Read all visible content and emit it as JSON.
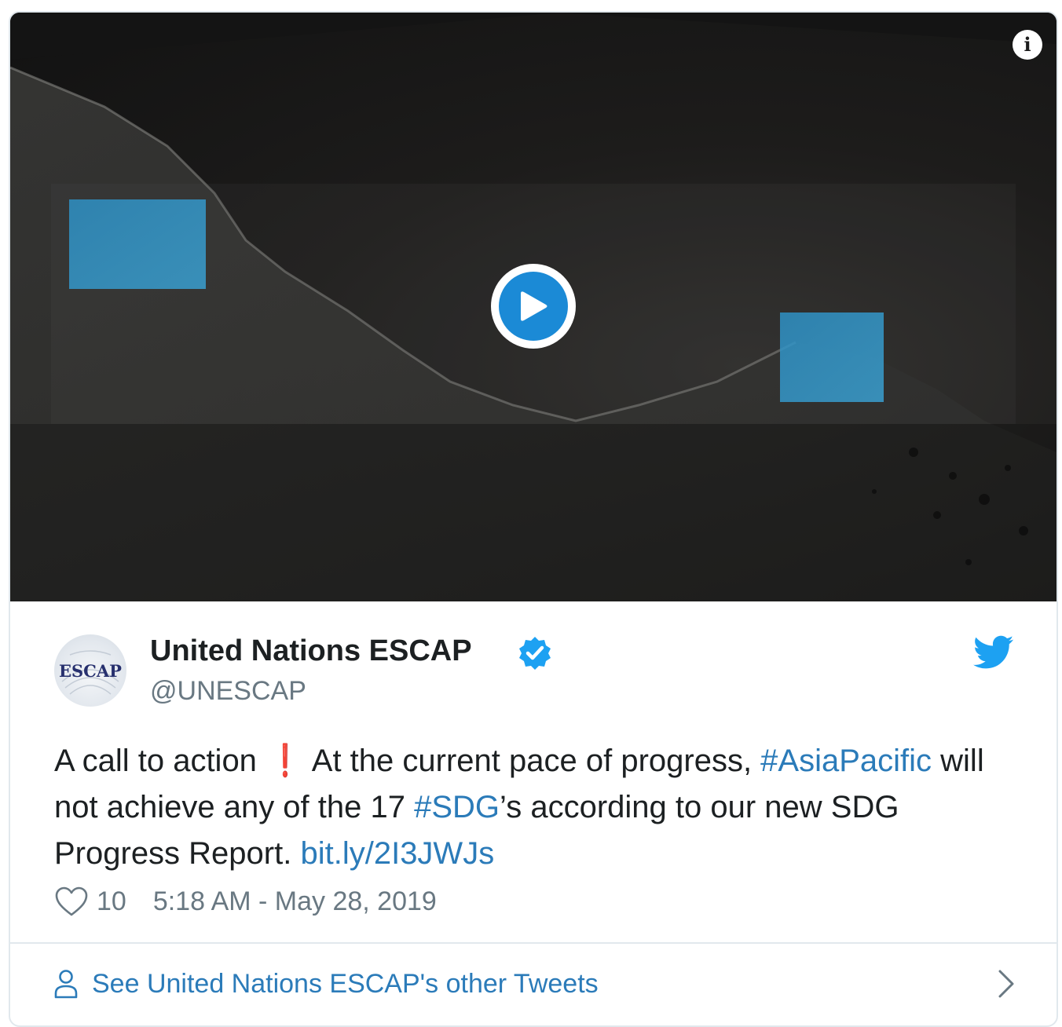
{
  "video": {
    "info_icon": "info-icon",
    "play_icon": "play-icon",
    "accent": "#1b8ad6"
  },
  "author": {
    "avatar_text": "ESCAP",
    "name": "United Nations ESCAP",
    "handle": "@UNESCAP",
    "verified_icon": "verified-badge-icon",
    "brand_icon": "twitter-bird-icon"
  },
  "tweet": {
    "part1": "A call to action ",
    "exclamation": "❗",
    "part2": " At the current pace of progress, ",
    "hashtag1": "#AsiaPacific",
    "part3": " will not achieve any of the 17 ",
    "hashtag2": "#SDG",
    "part4": "’s according to our new SDG Progress Report. ",
    "link": "bit.ly/2I3JWJs"
  },
  "meta": {
    "like_count": "10",
    "timestamp": "5:18 AM - May 28, 2019",
    "heart_icon": "heart-icon"
  },
  "footer": {
    "label": "See United Nations ESCAP's other Tweets",
    "person_icon": "person-icon",
    "chevron_icon": "chevron-right-icon"
  },
  "colors": {
    "link": "#2b7bb9",
    "text": "#1c2022",
    "muted": "#697882",
    "twitter": "#1da1f2",
    "border": "#e1e8ed"
  }
}
